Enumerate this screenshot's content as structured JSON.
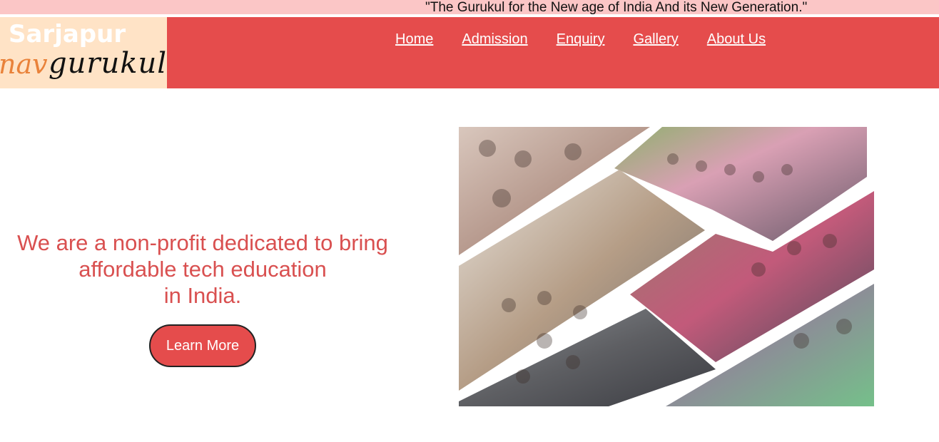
{
  "banner": {
    "tagline": "\"The Gurukul for the New age of India And its New Generation.\""
  },
  "logo": {
    "line1": "Sarjapur",
    "line2_part1": "nav",
    "line2_part2": "gurukul"
  },
  "nav": {
    "items": [
      {
        "label": "Home"
      },
      {
        "label": "Admission"
      },
      {
        "label": "Enquiry"
      },
      {
        "label": "Gallery"
      },
      {
        "label": "About Us"
      }
    ]
  },
  "hero": {
    "line1": "We are a non-profit dedicated to bring",
    "line2": "affordable tech education",
    "line3": "in India.",
    "button_label": "Learn More"
  },
  "colors": {
    "banner_bg": "#fbc6c6",
    "header_bg": "#e54c4c",
    "logo_bg": "#ffe3c6",
    "hero_text": "#d95050",
    "button_bg": "#e54c4c"
  }
}
